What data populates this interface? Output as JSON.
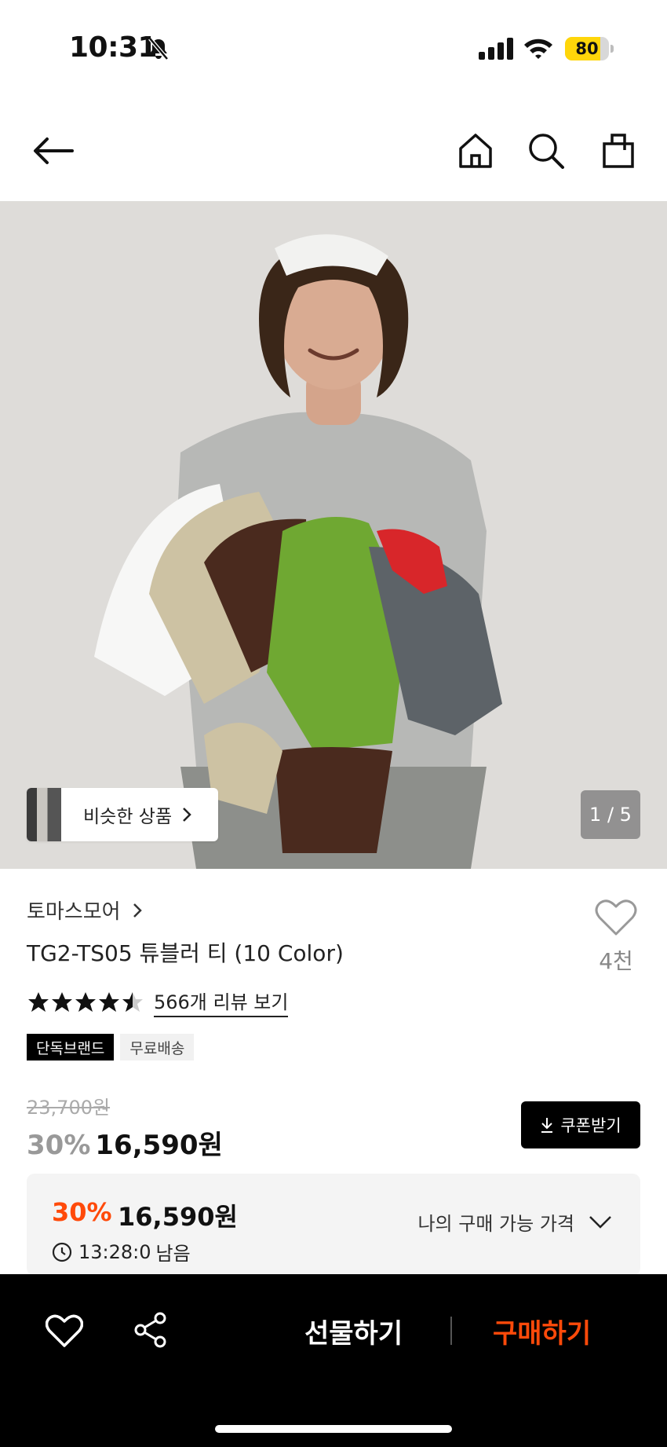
{
  "status_bar": {
    "time": "10:31",
    "battery": "80",
    "battery_level": 0.8
  },
  "product": {
    "brand": "토마스모어",
    "title": "TG2-TS05 튜블러 티 (10 Color)",
    "like_count": "4천",
    "rating": 4.5,
    "review_link": "566개 리뷰 보기",
    "tags": [
      "단독브랜드",
      "무료배송"
    ],
    "original_price": "23,700원",
    "discount": "30%",
    "sale_price": "16,590원",
    "coupon_button": "쿠폰받기"
  },
  "gallery": {
    "similar_label": "비슷한 상품",
    "page_indicator": "1 / 5"
  },
  "price_box": {
    "discount": "30%",
    "price": "16,590원",
    "timer": "13:28:0",
    "timer_suffix": "남음",
    "my_price_label": "나의 구매 가능 가격"
  },
  "bottom_bar": {
    "gift_label": "선물하기",
    "buy_label": "구매하기"
  },
  "colors": {
    "accent": "#ff4a0a",
    "battery": "#ffd60a"
  }
}
